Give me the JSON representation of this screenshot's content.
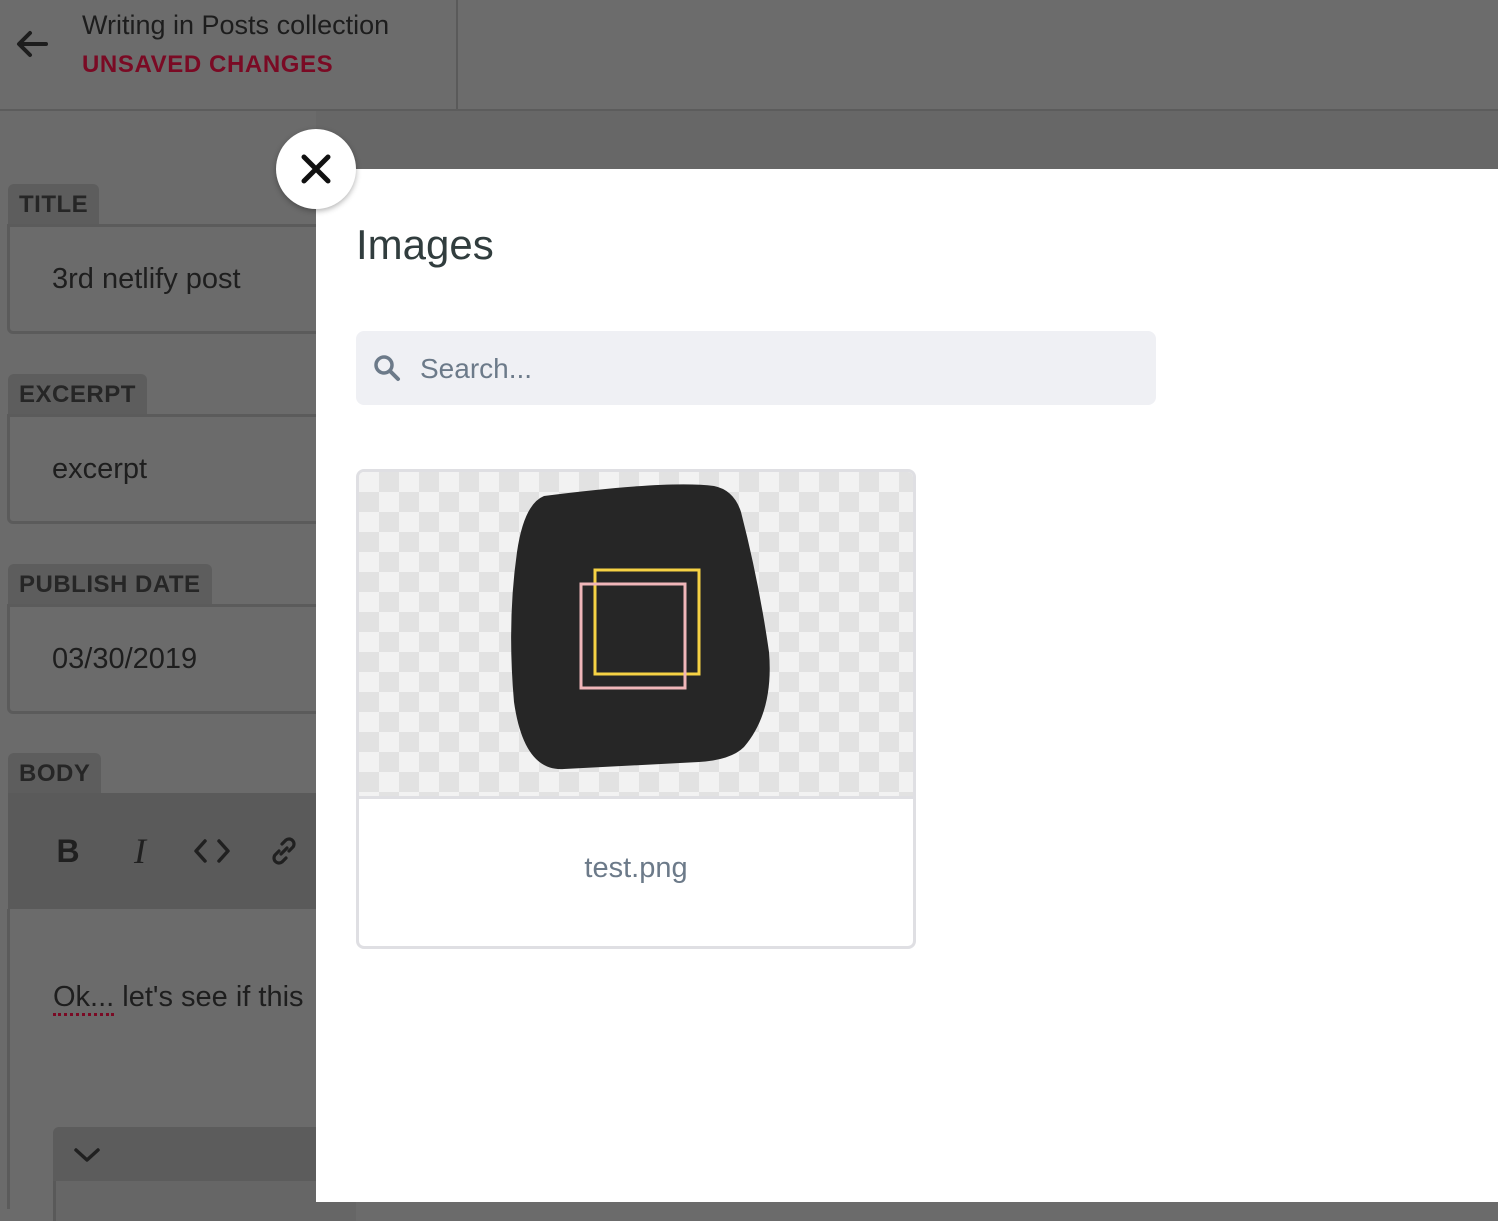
{
  "header": {
    "back_icon": "arrow-left-icon",
    "title": "Writing in Posts collection",
    "status": "UNSAVED CHANGES"
  },
  "fields": {
    "title": {
      "label": "TITLE",
      "value": "3rd netlify post"
    },
    "excerpt": {
      "label": "EXCERPT",
      "value": "excerpt"
    },
    "publish_date": {
      "label": "PUBLISH DATE",
      "value": "03/30/2019"
    },
    "body": {
      "label": "BODY",
      "toolbar": {
        "bold": "B",
        "italic": "I",
        "code_icon": "code-icon",
        "link_icon": "link-icon"
      },
      "text_first_word": "Ok...",
      "text_rest": " let's see if this"
    }
  },
  "modal": {
    "close_icon": "close-icon",
    "title": "Images",
    "search": {
      "placeholder": "Search...",
      "value": "",
      "icon": "search-icon"
    },
    "items": [
      {
        "name": "test.png"
      }
    ]
  },
  "colors": {
    "status_red": "#7a0a24",
    "modal_bg": "#ffffff",
    "search_bg": "#eff0f4",
    "text_dark": "#313d3e",
    "text_muted": "#6c7a89",
    "overlay_gray": "#6b6b6b"
  }
}
